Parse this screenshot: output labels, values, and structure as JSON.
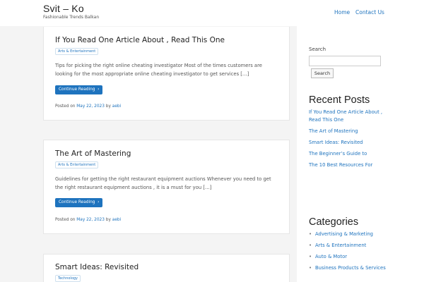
{
  "site": {
    "title": "Svit – Ko",
    "tagline": "Fashionable Trends Balkan"
  },
  "nav": {
    "home": "Home",
    "contact": "Contact Us"
  },
  "posts": [
    {
      "title": "If You Read One Article About , Read This One",
      "category": "Arts & Entertainment",
      "excerpt": "Tips for picking the right online cheating investigator Most of the times customers are looking for the most appropriate online cheating investigator to get services […]",
      "button": "Continue Reading",
      "posted_on": "Posted on",
      "date": "May 22, 2023",
      "by": "by",
      "author": "aebi"
    },
    {
      "title": "The Art of Mastering",
      "category": "Arts & Entertainment",
      "excerpt": "Guidelines for getting the right restaurant equipment auctions Whenever you need to get the right restaurant equipment auctions , it is a must for you […]",
      "button": "Continue Reading",
      "posted_on": "Posted on",
      "date": "May 22, 2023",
      "by": "by",
      "author": "aebi"
    },
    {
      "title": "Smart Ideas: Revisited",
      "category": "Technology"
    }
  ],
  "sidebar": {
    "search_label": "Search",
    "search_button": "Search",
    "recent_title": "Recent Posts",
    "recent": [
      "If You Read One Article About , Read This One",
      "The Art of Mastering",
      "Smart Ideas: Revisited",
      "The Beginner’s Guide to",
      "The 10 Best Resources For"
    ],
    "categories_title": "Categories",
    "categories": [
      "Advertising & Marketing",
      "Arts & Entertainment",
      "Auto & Motor",
      "Business Products & Services"
    ]
  },
  "icons": {
    "chevron": "chevron-right-icon",
    "bullet": "bullet-icon"
  },
  "colors": {
    "accent": "#1e73be",
    "background": "#f4f4f4"
  }
}
